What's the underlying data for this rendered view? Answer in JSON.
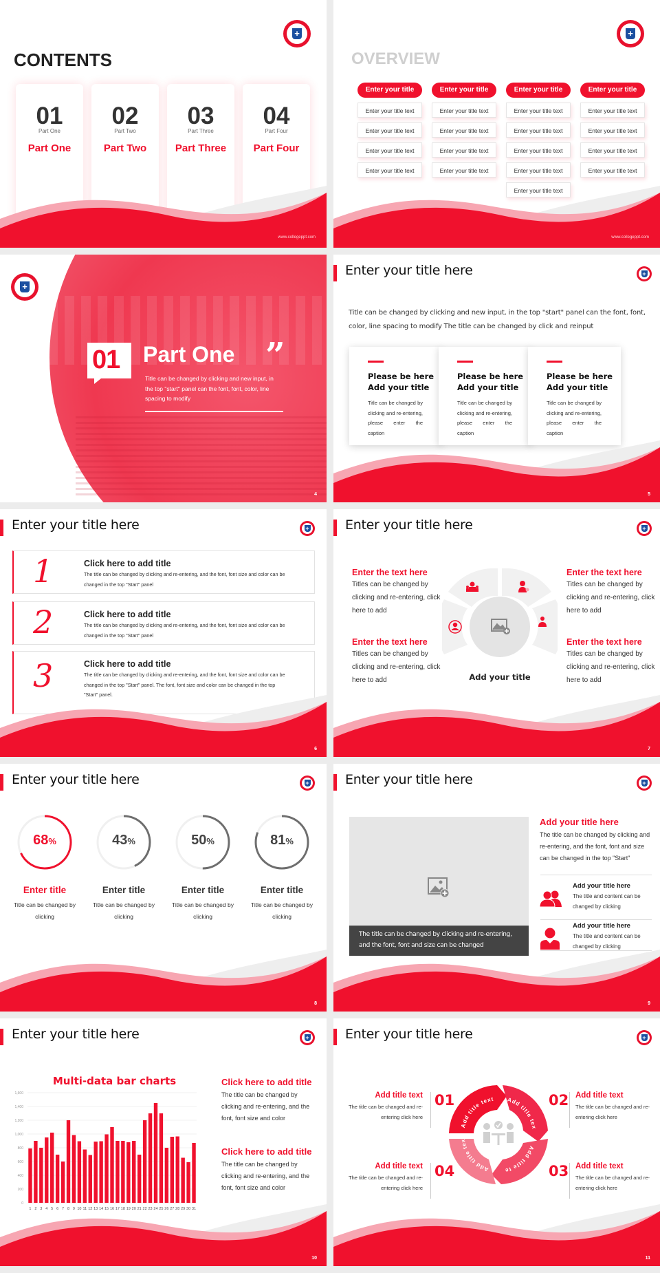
{
  "theme": {
    "accent": "#f0112d",
    "accent_light": "#f7a6b2",
    "gray_ring": "#6e6e6e",
    "background": "#ececec"
  },
  "slides": {
    "s1": {
      "heading": "CONTENTS",
      "url": "www.collegeppt.com",
      "cards": [
        {
          "num": "01",
          "sub": "Part One",
          "label": "Part One"
        },
        {
          "num": "02",
          "sub": "Part Two",
          "label": "Part Two"
        },
        {
          "num": "03",
          "sub": "Part Three",
          "label": "Part Three"
        },
        {
          "num": "04",
          "sub": "Part Four",
          "label": "Part Four"
        }
      ]
    },
    "s2": {
      "heading": "OVERVIEW",
      "url": "www.collegeppt.com",
      "columns": [
        {
          "title": "Enter your title",
          "items": [
            "Enter your title text",
            "Enter your title text",
            "Enter your title text",
            "Enter your title text"
          ]
        },
        {
          "title": "Enter your title",
          "items": [
            "Enter your title text",
            "Enter your title text",
            "Enter your title text",
            "Enter your title text"
          ]
        },
        {
          "title": "Enter your title",
          "items": [
            "Enter your title text",
            "Enter your title text",
            "Enter your title text",
            "Enter your title text",
            "Enter your title text"
          ]
        },
        {
          "title": "Enter your title",
          "items": [
            "Enter your title text",
            "Enter your title text",
            "Enter your title text",
            "Enter your title text"
          ]
        }
      ]
    },
    "s3": {
      "num": "01",
      "title": "Part One",
      "quote": "”",
      "desc": "Title can be changed by clicking and new input, in the top \"start\" panel can the font, font, color, line spacing to modify",
      "page": "4"
    },
    "s4": {
      "title": "Enter your title here",
      "intro": "Title can be changed by clicking and new input, in the top \"start\" panel can the font, font, color, line spacing to modify The title can be changed by click and reinput",
      "cards": [
        {
          "h1": "Please be here",
          "h2": "Add your title",
          "text": "Title can be changed by clicking and re-entering, please enter the caption"
        },
        {
          "h1": "Please be here",
          "h2": "Add your title",
          "text": "Title can be changed by clicking and re-entering, please enter the caption"
        },
        {
          "h1": "Please be here",
          "h2": "Add your title",
          "text": "Title can be changed by clicking and re-entering, please enter the caption"
        }
      ],
      "page": "5"
    },
    "s5": {
      "title": "Enter your title here",
      "rows": [
        {
          "num": "1",
          "title": "Click here to add title",
          "text": "The title can be changed by clicking and re-entering, and the font, font size and color can be changed in the top \"Start\" panel"
        },
        {
          "num": "2",
          "title": "Click here to add title",
          "text": "The title can be changed by clicking and re-entering, and the font, font size and color can be changed in the top \"Start\" panel"
        },
        {
          "num": "3",
          "title": "Click here to add title",
          "text": "The title can be changed by clicking and re-entering, and the font, font size and color can be changed in the top \"Start\" panel. The font, font size and color can be changed in the top \"Start\" panel."
        }
      ],
      "page": "6"
    },
    "s6": {
      "title": "Enter your title here",
      "blocks": [
        {
          "heading": "Enter the text here",
          "text": "Titles can be changed by clicking and re-entering, click here to add"
        },
        {
          "heading": "Enter the text here",
          "text": "Titles can be changed by clicking and re-entering, click here to add"
        },
        {
          "heading": "Enter the text here",
          "text": "Titles can be changed by clicking and re-entering, click here to add"
        },
        {
          "heading": "Enter the text here",
          "text": "Titles can be changed by clicking and re-entering, click here to add"
        }
      ],
      "center_caption": "Add your title",
      "icons": [
        "person-cycle-icon",
        "team-icon",
        "support-agent-icon",
        "reader-icon"
      ],
      "page": "7"
    },
    "s7": {
      "title": "Enter your title here",
      "rings": [
        {
          "percent": 68,
          "title": "Enter title",
          "desc": "Title can be changed by clicking",
          "highlight": true
        },
        {
          "percent": 43,
          "title": "Enter title",
          "desc": "Title can be changed by clicking",
          "highlight": false
        },
        {
          "percent": 50,
          "title": "Enter title",
          "desc": "Title can be changed by clicking",
          "highlight": false
        },
        {
          "percent": 81,
          "title": "Enter title",
          "desc": "Title can be changed by clicking",
          "highlight": false
        }
      ],
      "percent_sign": "%",
      "page": "8"
    },
    "s8": {
      "title": "Enter your title here",
      "caption": "The title can be changed by clicking and re-entering, and the font, font and size can be changed",
      "main_heading": "Add your title here",
      "main_text": "The title can be changed by clicking and re-entering, and the font, font and size can be changed in the top \"Start\"",
      "items": [
        {
          "heading": "Add your title here",
          "text": "The title and content can be changed by clicking",
          "icon": "group-icon"
        },
        {
          "heading": "Add your title here",
          "text": "The title and content can be changed by clicking",
          "icon": "user-icon"
        }
      ],
      "page": "9"
    },
    "s9": {
      "title": "Enter your title here",
      "blocks": [
        {
          "heading": "Click here to add title",
          "text": "The title can be changed by clicking and re-entering, and the font, font size and color"
        },
        {
          "heading": "Click here to add title",
          "text": "The title can be changed by clicking and re-entering, and the font, font size and color"
        }
      ],
      "page": "10"
    },
    "s10": {
      "title": "Enter your title here",
      "segments": [
        "Add title text",
        "Add title text",
        "Add title text",
        "Add title text"
      ],
      "blocks": [
        {
          "num": "01",
          "heading": "Add title text",
          "text": "The title can be changed and re-entering click here"
        },
        {
          "num": "02",
          "heading": "Add title text",
          "text": "The title can be changed and re-entering click here"
        },
        {
          "num": "03",
          "heading": "Add title text",
          "text": "The title can be changed and re-entering click here"
        },
        {
          "num": "04",
          "heading": "Add title text",
          "text": "The title can be changed and re-entering click here"
        }
      ],
      "page": "11"
    }
  },
  "chart_data": {
    "type": "bar",
    "title": "Multi-data bar charts",
    "xlabel": "",
    "ylabel": "",
    "categories": [
      "1",
      "2",
      "3",
      "4",
      "5",
      "6",
      "7",
      "8",
      "9",
      "10",
      "11",
      "12",
      "13",
      "14",
      "15",
      "16",
      "17",
      "18",
      "19",
      "20",
      "21",
      "22",
      "23",
      "24",
      "25",
      "26",
      "27",
      "28",
      "29",
      "30",
      "31"
    ],
    "values": [
      790,
      900,
      800,
      950,
      1020,
      700,
      600,
      1200,
      985,
      895,
      775,
      695,
      890,
      895,
      995,
      1100,
      900,
      900,
      880,
      900,
      700,
      1200,
      1300,
      1450,
      1300,
      800,
      960,
      965,
      655,
      590,
      870
    ],
    "ylim": [
      0,
      1600
    ],
    "yticks": [
      "0",
      "200",
      "400",
      "600",
      "800",
      "1,000",
      "1,200",
      "1,400",
      "1,600"
    ],
    "grid": true,
    "legend": "none"
  }
}
